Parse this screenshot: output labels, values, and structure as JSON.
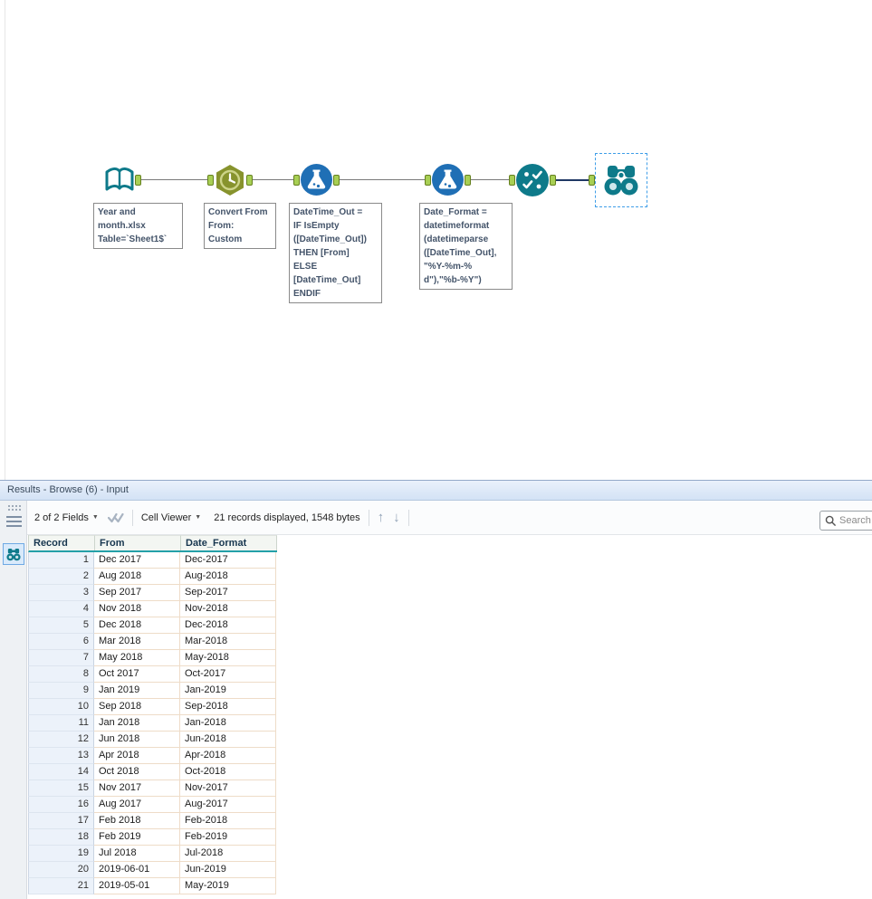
{
  "canvas": {
    "tools": [
      {
        "id": "input-data",
        "annotation": "Year and\nmonth.xlsx\nTable=`Sheet1$`"
      },
      {
        "id": "datetime-convert",
        "annotation": "Convert From\nFrom:\nCustom"
      },
      {
        "id": "formula-1",
        "annotation": "DateTime_Out =\nIF IsEmpty\n([DateTime_Out])\nTHEN [From]\nELSE\n[DateTime_Out]\nENDIF"
      },
      {
        "id": "formula-2",
        "annotation": "Date_Format =\ndatetimeformat\n(datetimeparse\n([DateTime_Out],\n\"%Y-%m-%\nd\"),\"%b-%Y\")"
      },
      {
        "id": "select"
      },
      {
        "id": "browse"
      }
    ]
  },
  "results_panel": {
    "title": "Results - Browse (6) - Input",
    "toolbar": {
      "fields_dropdown": "2 of 2 Fields",
      "cell_viewer_dropdown": "Cell Viewer",
      "records_status": "21 records displayed, 1548 bytes",
      "search_placeholder": "Search"
    },
    "table": {
      "columns": [
        "Record",
        "From",
        "Date_Format"
      ],
      "rows": [
        [
          "1",
          "Dec 2017",
          "Dec-2017"
        ],
        [
          "2",
          "Aug 2018",
          "Aug-2018"
        ],
        [
          "3",
          "Sep 2017",
          "Sep-2017"
        ],
        [
          "4",
          "Nov 2018",
          "Nov-2018"
        ],
        [
          "5",
          "Dec 2018",
          "Dec-2018"
        ],
        [
          "6",
          "Mar 2018",
          "Mar-2018"
        ],
        [
          "7",
          "May 2018",
          "May-2018"
        ],
        [
          "8",
          "Oct 2017",
          "Oct-2017"
        ],
        [
          "9",
          "Jan 2019",
          "Jan-2019"
        ],
        [
          "10",
          "Sep 2018",
          "Sep-2018"
        ],
        [
          "11",
          "Jan 2018",
          "Jan-2018"
        ],
        [
          "12",
          "Jun 2018",
          "Jun-2018"
        ],
        [
          "13",
          "Apr 2018",
          "Apr-2018"
        ],
        [
          "14",
          "Oct 2018",
          "Oct-2018"
        ],
        [
          "15",
          "Nov 2017",
          "Nov-2017"
        ],
        [
          "16",
          "Aug 2017",
          "Aug-2017"
        ],
        [
          "17",
          "Feb 2018",
          "Feb-2018"
        ],
        [
          "18",
          "Feb 2019",
          "Feb-2019"
        ],
        [
          "19",
          "Jul 2018",
          "Jul-2018"
        ],
        [
          "20",
          "2019-06-01",
          "Jun-2019"
        ],
        [
          "21",
          "2019-05-01",
          "May-2019"
        ]
      ]
    }
  },
  "colors": {
    "accent_teal": "#0e7a8a",
    "formula_blue": "#1f6fb5",
    "datetime_olive": "#87932d",
    "anchor_green": "#a8cf54",
    "selection_blue": "#3f9ee8",
    "header_underline_teal": "#24a0a8",
    "record_column_bg": "#ecf2fa"
  }
}
